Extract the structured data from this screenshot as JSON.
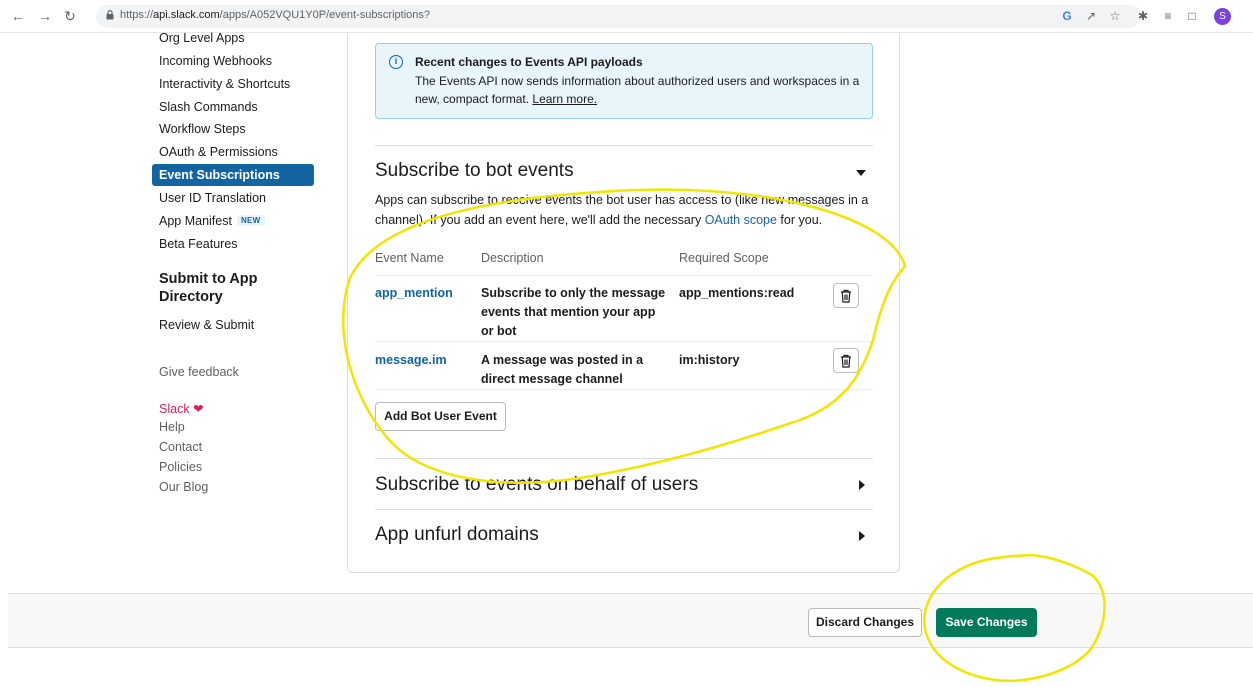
{
  "browser": {
    "url_prefix": "https://",
    "url_host": "api.slack.com",
    "url_path": "/apps/A052VQU1Y0P/event-subscriptions?",
    "profile_initial": "S"
  },
  "sidebar": {
    "items": [
      {
        "label": "Org Level Apps"
      },
      {
        "label": "Incoming Webhooks"
      },
      {
        "label": "Interactivity & Shortcuts"
      },
      {
        "label": "Slash Commands"
      },
      {
        "label": "Workflow Steps"
      },
      {
        "label": "OAuth & Permissions"
      },
      {
        "label": "Event Subscriptions"
      },
      {
        "label": "User ID Translation"
      },
      {
        "label": "App Manifest"
      },
      {
        "label": "Beta Features"
      }
    ],
    "new_badge": "NEW",
    "submit_heading": "Submit to App Directory",
    "review_submit": "Review & Submit",
    "give_feedback": "Give feedback",
    "footer": {
      "slack": "Slack",
      "help": "Help",
      "contact": "Contact",
      "policies": "Policies",
      "blog": "Our Blog"
    }
  },
  "banner": {
    "title": "Recent changes to Events API payloads",
    "body": "The Events API now sends information about authorized users and workspaces in a new, compact format.",
    "link": "Learn more."
  },
  "bot_events": {
    "title": "Subscribe to bot events",
    "desc_before": "Apps can subscribe to receive events the bot user has access to (like new messages in a channel). If you add an event here, we'll add the necessary ",
    "desc_link": "OAuth scope",
    "desc_after": " for you.",
    "columns": [
      "Event Name",
      "Description",
      "Required Scope"
    ],
    "rows": [
      {
        "name": "app_mention",
        "description": "Subscribe to only the message events that mention your app or bot",
        "scope": "app_mentions:read"
      },
      {
        "name": "message.im",
        "description": "A message was posted in a direct message channel",
        "scope": "im:history"
      }
    ],
    "add_button": "Add Bot User Event"
  },
  "user_events": {
    "title": "Subscribe to events on behalf of users"
  },
  "unfurl": {
    "title": "App unfurl domains"
  },
  "footer_bar": {
    "discard": "Discard Changes",
    "save": "Save Changes"
  },
  "colors": {
    "accent_blue": "#1264a3",
    "save_green": "#007a5a",
    "annotation_yellow": "#f2e600",
    "slack_heart": "#e01e5a"
  }
}
